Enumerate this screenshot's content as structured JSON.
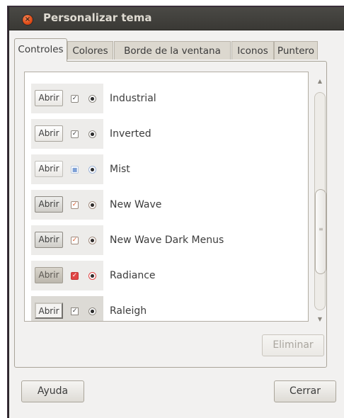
{
  "window": {
    "title": "Personalizar tema"
  },
  "tabs": [
    {
      "label": "Controles",
      "active": true
    },
    {
      "label": "Colores",
      "active": false
    },
    {
      "label": "Borde de la ventana",
      "active": false
    },
    {
      "label": "Iconos",
      "active": false
    },
    {
      "label": "Puntero",
      "active": false
    }
  ],
  "themes": [
    {
      "name": "Industrial",
      "preview_button": "Abrir",
      "preview_check": "✓",
      "check_color": "#3c3c3c",
      "radio_color": "#2e2e2e",
      "button_style": "flat"
    },
    {
      "name": "Inverted",
      "preview_button": "Abrir",
      "preview_check": "✓",
      "check_color": "#3c3c3c",
      "radio_color": "#2e2e2e",
      "button_style": "flat"
    },
    {
      "name": "Mist",
      "preview_button": "Abrir",
      "preview_check": "■",
      "check_color": "#7ea0d6",
      "radio_color": "#7ea0d6",
      "button_style": "flat"
    },
    {
      "name": "New Wave",
      "preview_button": "Abrir",
      "preview_check": "✓",
      "check_color": "#d9592b",
      "radio_color": "#d9592b",
      "button_style": "gray"
    },
    {
      "name": "New Wave Dark Menus",
      "preview_button": "Abrir",
      "preview_check": "✓",
      "check_color": "#d9592b",
      "radio_color": "#d9592b",
      "button_style": "gray"
    },
    {
      "name": "Radiance",
      "preview_button": "Abrir",
      "preview_check": "✓",
      "check_color": "#e04545",
      "radio_color": "#e04545",
      "button_style": "dark"
    },
    {
      "name": "Raleigh",
      "preview_button": "Abrir",
      "preview_check": "✓",
      "check_color": "#3c3c3c",
      "radio_color": "#2e2e2e",
      "button_style": "raleigh"
    }
  ],
  "buttons": {
    "eliminar": "Eliminar",
    "ayuda": "Ayuda",
    "cerrar": "Cerrar"
  },
  "scrollbar": {
    "up_arrow": "▲",
    "down_arrow": "▼",
    "grip": "≡"
  },
  "colors": {
    "titlebar": "#3c3b37",
    "close_button": "#e8592c",
    "window_bg": "#f2f1f0"
  }
}
